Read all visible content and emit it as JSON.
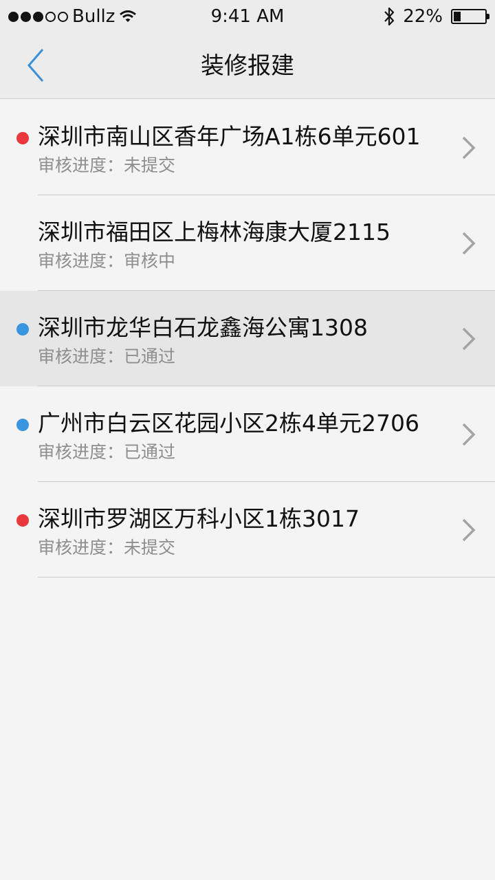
{
  "status_bar": {
    "carrier": "Bullz",
    "time": "9:41 AM",
    "battery_percent": "22%",
    "battery_level": 0.22,
    "signal_bars_filled": 3,
    "signal_bars_total": 5,
    "icons": [
      "wifi-icon",
      "bluetooth-icon",
      "battery-icon"
    ]
  },
  "nav": {
    "title": "装修报建",
    "back_icon": "chevron-left-icon",
    "accent_color": "#3a8fd6"
  },
  "list": {
    "status_label": "审核进度：",
    "items": [
      {
        "title": "深圳市南山区香年广场A1栋6单元601",
        "status": "未提交",
        "dot_color": "#e8383b",
        "highlighted": false
      },
      {
        "title": "深圳市福田区上梅林海康大厦2115",
        "status": "审核中",
        "dot_color": "",
        "highlighted": false
      },
      {
        "title": "深圳市龙华白石龙鑫海公寓1308",
        "status": "已通过",
        "dot_color": "#3a95e0",
        "highlighted": true
      },
      {
        "title": "广州市白云区花园小区2栋4单元2706",
        "status": "已通过",
        "dot_color": "#3a95e0",
        "highlighted": false
      },
      {
        "title": "深圳市罗湖区万科小区1栋3017",
        "status": "未提交",
        "dot_color": "#e8383b",
        "highlighted": false
      }
    ]
  }
}
